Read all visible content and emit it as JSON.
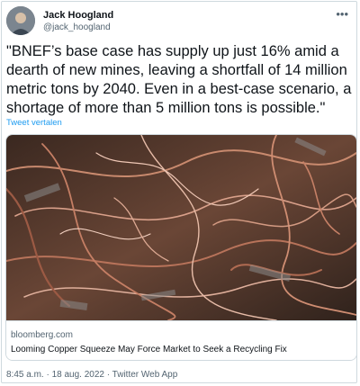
{
  "author": {
    "name": "Jack Hoogland",
    "handle": "@jack_hoogland"
  },
  "tweet": {
    "text": "\"BNEF’s base case has supply up just 16% amid a\ndearth of new mines, leaving a shortfall of 14 million\nmetric tons by 2040. Even in a best-case scenario, a\nshortage of more than 5 million tons is possible.\"",
    "translate_label": "Tweet vertalen"
  },
  "link_card": {
    "domain": "bloomberg.com",
    "headline": "Looming Copper Squeeze May Force Market to Seek a Recycling Fix"
  },
  "meta": {
    "timestamp_line": "8:45 a.m. · 18 aug. 2022 · Twitter Web App"
  },
  "colors": {
    "link_blue": "#1d9bf0",
    "copper": "#b86a4a",
    "secondary_text": "#536471"
  },
  "icons": {
    "more": "more-options-icon",
    "avatar": "avatar-image"
  }
}
